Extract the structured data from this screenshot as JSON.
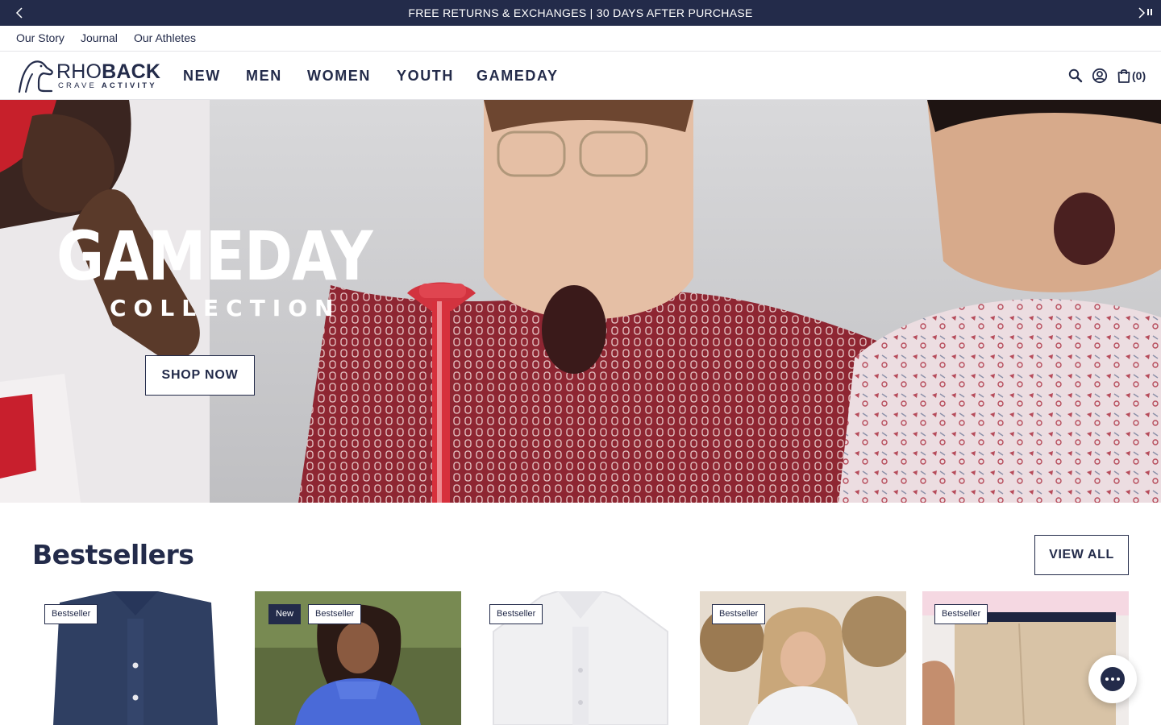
{
  "announcement": {
    "text": "FREE RETURNS & EXCHANGES  |  30 DAYS AFTER PURCHASE",
    "prev_icon": "chevron-left-icon",
    "next_icon": "chevron-right-icon",
    "pause_icon": "pause-icon"
  },
  "utility_nav": [
    "Our Story",
    "Journal",
    "Our Athletes"
  ],
  "header": {
    "logo_word_light": "RHO",
    "logo_word_bold": "BACK",
    "logo_tag_light": "CRAVE ",
    "logo_tag_bold": "ACTIVITY",
    "nav": [
      "NEW",
      "MEN",
      "WOMEN",
      "YOUTH",
      "GAMEDAY"
    ],
    "cart_count": "(0)",
    "icons": [
      "search-icon",
      "account-icon",
      "cart-icon"
    ]
  },
  "hero": {
    "title": "GAMEDAY",
    "subtitle": "COLLECTION",
    "cta": "SHOP NOW"
  },
  "bestsellers": {
    "title": "Bestsellers",
    "view_all": "VIEW ALL",
    "products": [
      {
        "badges": [
          "Bestseller"
        ],
        "new": false
      },
      {
        "badges": [
          "New",
          "Bestseller"
        ],
        "new": true
      },
      {
        "badges": [
          "Bestseller"
        ],
        "new": false
      },
      {
        "badges": [
          "Bestseller"
        ],
        "new": false
      },
      {
        "badges": [
          "Bestseller"
        ],
        "new": false
      }
    ],
    "badge_labels": {
      "p1": "Bestseller",
      "p2_new": "New",
      "p2": "Bestseller",
      "p3": "Bestseller",
      "p4": "Bestseller",
      "p5": "Bestseller"
    }
  },
  "chat": {
    "icon": "chat-icon"
  },
  "colors": {
    "navy": "#232b4a",
    "accent_red": "#a3333d",
    "white": "#ffffff"
  }
}
